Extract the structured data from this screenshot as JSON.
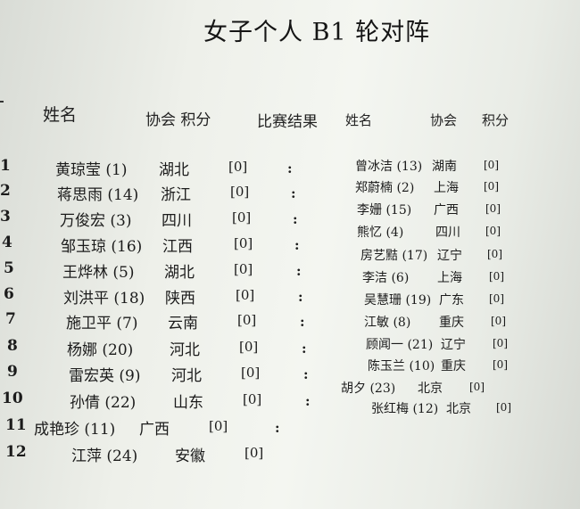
{
  "title": "女子个人 B1 轮对阵",
  "headers": {
    "left_name": "姓名",
    "left_assoc_points": "协会 积分",
    "result": "比赛结果",
    "right_name": "姓名",
    "right_assoc": "协会",
    "right_points": "积分"
  },
  "rows": [
    {
      "table": "1",
      "l_name": "黄琼莹 (1)",
      "l_assoc": "湖北",
      "l_score": "[0]",
      "colon": ":",
      "r_name": "曾冰洁 (13)",
      "r_assoc": "湖南",
      "r_score": "[0]"
    },
    {
      "table": "2",
      "l_name": "蒋思雨 (14)",
      "l_assoc": "浙江",
      "l_score": "[0]",
      "colon": ":",
      "r_name": "郑蔚楠 (2)",
      "r_assoc": "上海",
      "r_score": "[0]"
    },
    {
      "table": "3",
      "l_name": "万俊宏 (3)",
      "l_assoc": "四川",
      "l_score": "[0]",
      "colon": ":",
      "r_name": "李姗 (15)",
      "r_assoc": "广西",
      "r_score": "[0]"
    },
    {
      "table": "4",
      "l_name": "邹玉琼 (16)",
      "l_assoc": "江西",
      "l_score": "[0]",
      "colon": ":",
      "r_name": "熊忆 (4)",
      "r_assoc": "四川",
      "r_score": "[0]"
    },
    {
      "table": "5",
      "l_name": "王烨林 (5)",
      "l_assoc": "湖北",
      "l_score": "[0]",
      "colon": ":",
      "r_name": "房艺黠 (17)",
      "r_assoc": "辽宁",
      "r_score": "[0]"
    },
    {
      "table": "6",
      "l_name": "刘洪平 (18)",
      "l_assoc": "陕西",
      "l_score": "[0]",
      "colon": ":",
      "r_name": "李洁 (6)",
      "r_assoc": "上海",
      "r_score": "[0]"
    },
    {
      "table": "7",
      "l_name": "施卫平 (7)",
      "l_assoc": "云南",
      "l_score": "[0]",
      "colon": ":",
      "r_name": "吴慧珊 (19)",
      "r_assoc": "广东",
      "r_score": "[0]"
    },
    {
      "table": "8",
      "l_name": "杨娜 (20)",
      "l_assoc": "河北",
      "l_score": "[0]",
      "colon": ":",
      "r_name": "江敏 (8)",
      "r_assoc": "重庆",
      "r_score": "[0]"
    },
    {
      "table": "9",
      "l_name": "雷宏英 (9)",
      "l_assoc": "河北",
      "l_score": "[0]",
      "colon": ":",
      "r_name": "顾闻一 (21)",
      "r_assoc": "辽宁",
      "r_score": "[0]"
    },
    {
      "table": "10",
      "l_name": "孙倩 (22)",
      "l_assoc": "山东",
      "l_score": "[0]",
      "colon": ":",
      "r_name": "陈玉兰 (10)",
      "r_assoc": "重庆",
      "r_score": "[0]"
    },
    {
      "table": "11",
      "l_name": "成艳珍 (11)",
      "l_assoc": "广西",
      "l_score": "[0]",
      "colon": ":",
      "r_name": "胡夕 (23)",
      "r_assoc": "北京",
      "r_score": "[0]"
    },
    {
      "table": "12",
      "l_name": "江萍 (24)",
      "l_assoc": "安徽",
      "l_score": "[0]",
      "colon": "",
      "r_name": "张红梅 (12)",
      "r_assoc": "北京",
      "r_score": "[0]"
    }
  ]
}
